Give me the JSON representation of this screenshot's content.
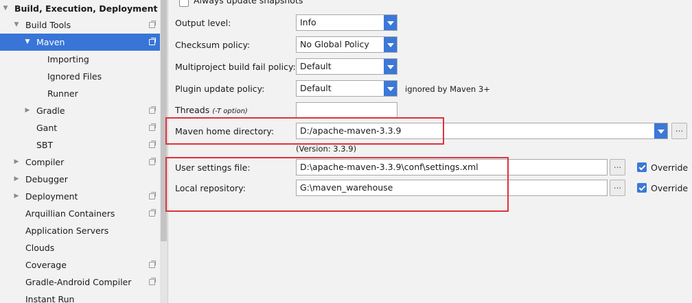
{
  "sidebar": {
    "items": [
      {
        "label": "Build, Execution, Deployment",
        "arrow": "▼",
        "bold": true,
        "selected": false,
        "project_icon": false
      },
      {
        "label": "Build Tools",
        "arrow": "▼",
        "bold": false,
        "selected": false,
        "project_icon": true
      },
      {
        "label": "Maven",
        "arrow": "▼",
        "bold": false,
        "selected": true,
        "project_icon": true
      },
      {
        "label": "Importing",
        "arrow": "",
        "bold": false,
        "selected": false,
        "project_icon": false
      },
      {
        "label": "Ignored Files",
        "arrow": "",
        "bold": false,
        "selected": false,
        "project_icon": false
      },
      {
        "label": "Runner",
        "arrow": "",
        "bold": false,
        "selected": false,
        "project_icon": false
      },
      {
        "label": "Gradle",
        "arrow": "▶",
        "bold": false,
        "selected": false,
        "project_icon": true
      },
      {
        "label": "Gant",
        "arrow": "",
        "bold": false,
        "selected": false,
        "project_icon": true
      },
      {
        "label": "SBT",
        "arrow": "",
        "bold": false,
        "selected": false,
        "project_icon": true
      },
      {
        "label": "Compiler",
        "arrow": "▶",
        "bold": false,
        "selected": false,
        "project_icon": true
      },
      {
        "label": "Debugger",
        "arrow": "▶",
        "bold": false,
        "selected": false,
        "project_icon": false
      },
      {
        "label": "Deployment",
        "arrow": "▶",
        "bold": false,
        "selected": false,
        "project_icon": true
      },
      {
        "label": "Arquillian Containers",
        "arrow": "",
        "bold": false,
        "selected": false,
        "project_icon": true
      },
      {
        "label": "Application Servers",
        "arrow": "",
        "bold": false,
        "selected": false,
        "project_icon": false
      },
      {
        "label": "Clouds",
        "arrow": "",
        "bold": false,
        "selected": false,
        "project_icon": false
      },
      {
        "label": "Coverage",
        "arrow": "",
        "bold": false,
        "selected": false,
        "project_icon": true
      },
      {
        "label": "Gradle-Android Compiler",
        "arrow": "",
        "bold": false,
        "selected": false,
        "project_icon": true
      },
      {
        "label": "Instant Run",
        "arrow": "",
        "bold": false,
        "selected": false,
        "project_icon": false
      }
    ]
  },
  "settings": {
    "always_update_snapshots": {
      "label": "Always update snapshots",
      "checked": false
    },
    "output_level": {
      "label": "Output level:",
      "value": "Info"
    },
    "checksum_policy": {
      "label": "Checksum policy:",
      "value": "No Global Policy"
    },
    "multiproject_fail_policy": {
      "label": "Multiproject build fail policy:",
      "value": "Default"
    },
    "plugin_update_policy": {
      "label": "Plugin update policy:",
      "value": "Default",
      "note": "ignored by Maven 3+"
    },
    "threads": {
      "label": "Threads",
      "hint": "(-T option)",
      "value": ""
    },
    "maven_home": {
      "label": "Maven home directory:",
      "value": "D:/apache-maven-3.3.9",
      "version": "(Version: 3.3.9)"
    },
    "user_settings": {
      "label": "User settings file:",
      "value": "D:\\apache-maven-3.3.9\\conf\\settings.xml",
      "override_label": "Override",
      "override": true
    },
    "local_repo": {
      "label": "Local repository:",
      "value": "G:\\maven_warehouse",
      "override_label": "Override",
      "override": true
    },
    "browse_label": "..."
  },
  "colors": {
    "selection": "#3875d7",
    "accent": "#3b78d8",
    "highlight_box": "#e0313a"
  }
}
